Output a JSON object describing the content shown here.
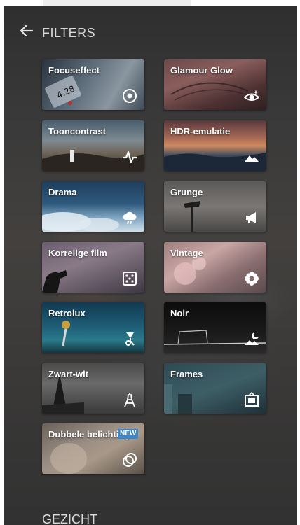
{
  "header": {
    "title": "FILTERS",
    "back_icon": "arrow-left-icon"
  },
  "filters": [
    {
      "label": "Focuseffect",
      "icon": "focus-target-icon"
    },
    {
      "label": "Glamour Glow",
      "icon": "eye-sparkle-icon"
    },
    {
      "label": "Tooncontrast",
      "icon": "pulse-icon"
    },
    {
      "label": "HDR-emulatie",
      "icon": "mountains-icon"
    },
    {
      "label": "Drama",
      "icon": "cloud-rain-icon"
    },
    {
      "label": "Grunge",
      "icon": "megaphone-icon"
    },
    {
      "label": "Korrelige film",
      "icon": "dice-icon"
    },
    {
      "label": "Vintage",
      "icon": "flower-icon"
    },
    {
      "label": "Retrolux",
      "icon": "pin-icon"
    },
    {
      "label": "Noir",
      "icon": "moon-landscape-icon"
    },
    {
      "label": "Zwart-wit",
      "icon": "eiffel-tower-icon"
    },
    {
      "label": "Frames",
      "icon": "frame-icon"
    },
    {
      "label": "Dubbele belichting",
      "icon": "double-circle-icon",
      "badge": "NEW"
    }
  ],
  "section": {
    "title": "GEZICHT"
  }
}
